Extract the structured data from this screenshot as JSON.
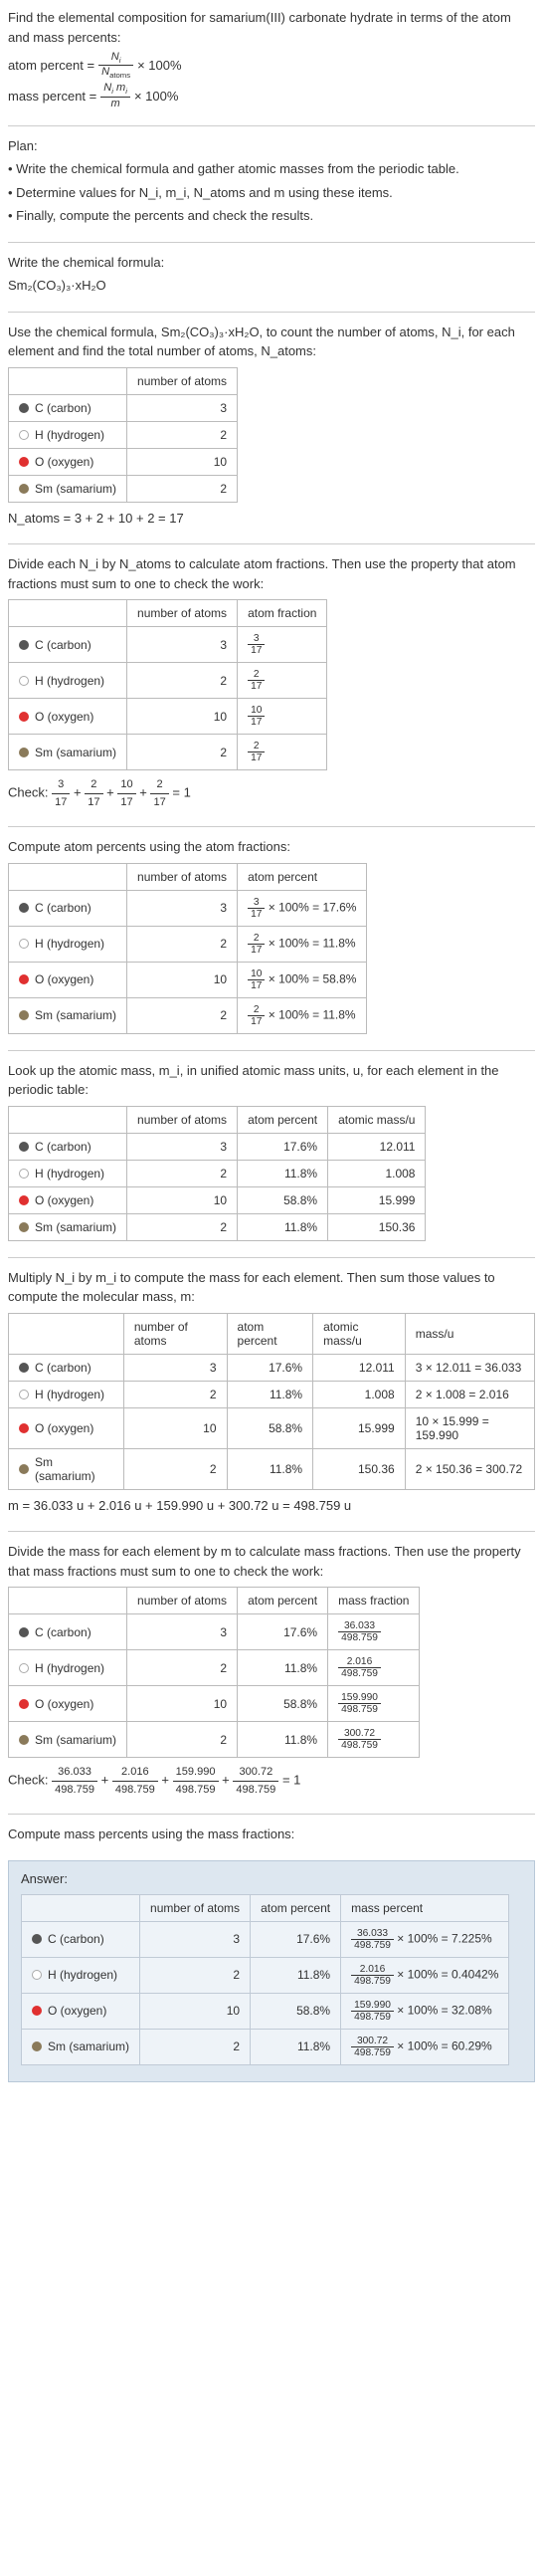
{
  "intro": {
    "line1": "Find the elemental composition for samarium(III) carbonate hydrate in terms of the atom and mass percents:",
    "atom_pct_label": "atom percent =",
    "atom_pct_rhs": "× 100%",
    "atom_pct_num": "N_i",
    "atom_pct_den": "N_atoms",
    "mass_pct_label": "mass percent =",
    "mass_pct_rhs": "× 100%",
    "mass_pct_num": "N_i m_i",
    "mass_pct_den": "m"
  },
  "plan": {
    "heading": "Plan:",
    "b1": "• Write the chemical formula and gather atomic masses from the periodic table.",
    "b2": "• Determine values for N_i, m_i, N_atoms and m using these items.",
    "b3": "• Finally, compute the percents and check the results."
  },
  "write_formula": {
    "heading": "Write the chemical formula:",
    "formula": "Sm₂(CO₃)₃·xH₂O"
  },
  "count_atoms": {
    "text": "Use the chemical formula, Sm₂(CO₃)₃·xH₂O, to count the number of atoms, N_i, for each element and find the total number of atoms, N_atoms:",
    "col_num": "number of atoms",
    "rows": [
      {
        "el": "C (carbon)",
        "n": "3"
      },
      {
        "el": "H (hydrogen)",
        "n": "2"
      },
      {
        "el": "O (oxygen)",
        "n": "10"
      },
      {
        "el": "Sm (samarium)",
        "n": "2"
      }
    ],
    "total": "N_atoms = 3 + 2 + 10 + 2 = 17"
  },
  "atom_fractions": {
    "text": "Divide each N_i by N_atoms to calculate atom fractions. Then use the property that atom fractions must sum to one to check the work:",
    "col_num": "number of atoms",
    "col_frac": "atom fraction",
    "rows": [
      {
        "el": "C (carbon)",
        "n": "3",
        "fnum": "3",
        "fden": "17"
      },
      {
        "el": "H (hydrogen)",
        "n": "2",
        "fnum": "2",
        "fden": "17"
      },
      {
        "el": "O (oxygen)",
        "n": "10",
        "fnum": "10",
        "fden": "17"
      },
      {
        "el": "Sm (samarium)",
        "n": "2",
        "fnum": "2",
        "fden": "17"
      }
    ],
    "check_label": "Check:",
    "check_expr": "3/17 + 2/17 + 10/17 + 2/17 = 1"
  },
  "atom_percents": {
    "text": "Compute atom percents using the atom fractions:",
    "col_num": "number of atoms",
    "col_pct": "atom percent",
    "rows": [
      {
        "el": "C (carbon)",
        "n": "3",
        "fnum": "3",
        "fden": "17",
        "pct": "17.6%"
      },
      {
        "el": "H (hydrogen)",
        "n": "2",
        "fnum": "2",
        "fden": "17",
        "pct": "11.8%"
      },
      {
        "el": "O (oxygen)",
        "n": "10",
        "fnum": "10",
        "fden": "17",
        "pct": "58.8%"
      },
      {
        "el": "Sm (samarium)",
        "n": "2",
        "fnum": "2",
        "fden": "17",
        "pct": "11.8%"
      }
    ]
  },
  "atomic_mass": {
    "text": "Look up the atomic mass, m_i, in unified atomic mass units, u, for each element in the periodic table:",
    "col_num": "number of atoms",
    "col_pct": "atom percent",
    "col_mass": "atomic mass/u",
    "rows": [
      {
        "el": "C (carbon)",
        "n": "3",
        "pct": "17.6%",
        "m": "12.011"
      },
      {
        "el": "H (hydrogen)",
        "n": "2",
        "pct": "11.8%",
        "m": "1.008"
      },
      {
        "el": "O (oxygen)",
        "n": "10",
        "pct": "58.8%",
        "m": "15.999"
      },
      {
        "el": "Sm (samarium)",
        "n": "2",
        "pct": "11.8%",
        "m": "150.36"
      }
    ]
  },
  "mass_each": {
    "text": "Multiply N_i by m_i to compute the mass for each element. Then sum those values to compute the molecular mass, m:",
    "col_num": "number of atoms",
    "col_pct": "atom percent",
    "col_mass": "atomic mass/u",
    "col_massu": "mass/u",
    "rows": [
      {
        "el": "C (carbon)",
        "n": "3",
        "pct": "17.6%",
        "m": "12.011",
        "calc": "3 × 12.011 = 36.033"
      },
      {
        "el": "H (hydrogen)",
        "n": "2",
        "pct": "11.8%",
        "m": "1.008",
        "calc": "2 × 1.008 = 2.016"
      },
      {
        "el": "O (oxygen)",
        "n": "10",
        "pct": "58.8%",
        "m": "15.999",
        "calc": "10 × 15.999 = 159.990"
      },
      {
        "el": "Sm (samarium)",
        "n": "2",
        "pct": "11.8%",
        "m": "150.36",
        "calc": "2 × 150.36 = 300.72"
      }
    ],
    "total": "m = 36.033 u + 2.016 u + 159.990 u + 300.72 u = 498.759 u"
  },
  "mass_fractions": {
    "text": "Divide the mass for each element by m to calculate mass fractions. Then use the property that mass fractions must sum to one to check the work:",
    "col_num": "number of atoms",
    "col_pct": "atom percent",
    "col_mf": "mass fraction",
    "rows": [
      {
        "el": "C (carbon)",
        "n": "3",
        "pct": "17.6%",
        "fnum": "36.033",
        "fden": "498.759"
      },
      {
        "el": "H (hydrogen)",
        "n": "2",
        "pct": "11.8%",
        "fnum": "2.016",
        "fden": "498.759"
      },
      {
        "el": "O (oxygen)",
        "n": "10",
        "pct": "58.8%",
        "fnum": "159.990",
        "fden": "498.759"
      },
      {
        "el": "Sm (samarium)",
        "n": "2",
        "pct": "11.8%",
        "fnum": "300.72",
        "fden": "498.759"
      }
    ],
    "check_label": "Check:",
    "check_parts": [
      {
        "num": "36.033",
        "den": "498.759"
      },
      {
        "num": "2.016",
        "den": "498.759"
      },
      {
        "num": "159.990",
        "den": "498.759"
      },
      {
        "num": "300.72",
        "den": "498.759"
      }
    ],
    "check_eq": "= 1"
  },
  "mass_percents": {
    "text": "Compute mass percents using the mass fractions:"
  },
  "answer": {
    "label": "Answer:",
    "col_num": "number of atoms",
    "col_pct": "atom percent",
    "col_mpct": "mass percent",
    "rows": [
      {
        "el": "C (carbon)",
        "n": "3",
        "pct": "17.6%",
        "fnum": "36.033",
        "fden": "498.759",
        "res": "100% = 7.225%"
      },
      {
        "el": "H (hydrogen)",
        "n": "2",
        "pct": "11.8%",
        "fnum": "2.016",
        "fden": "498.759",
        "res": "100% = 0.4042%"
      },
      {
        "el": "O (oxygen)",
        "n": "10",
        "pct": "58.8%",
        "fnum": "159.990",
        "fden": "498.759",
        "res": "100% = 32.08%"
      },
      {
        "el": "Sm (samarium)",
        "n": "2",
        "pct": "11.8%",
        "fnum": "300.72",
        "fden": "498.759",
        "res": "100% = 60.29%"
      }
    ]
  },
  "labels": {
    "c": "C (carbon)",
    "h": "H (hydrogen)",
    "o": "O (oxygen)",
    "sm": "Sm (samarium)",
    "times100": "× 100% =",
    "plus": " + "
  },
  "chart_data": {
    "type": "table",
    "title": "Elemental composition of Sm2(CO3)3·xH2O",
    "elements": [
      "C",
      "H",
      "O",
      "Sm"
    ],
    "number_of_atoms": [
      3,
      2,
      10,
      2
    ],
    "N_atoms_total": 17,
    "atom_fraction_num": [
      3,
      2,
      10,
      2
    ],
    "atom_fraction_den": 17,
    "atom_percent": [
      17.6,
      11.8,
      58.8,
      11.8
    ],
    "atomic_mass_u": [
      12.011,
      1.008,
      15.999,
      150.36
    ],
    "mass_u": [
      36.033,
      2.016,
      159.99,
      300.72
    ],
    "m_total_u": 498.759,
    "mass_fraction_num": [
      36.033,
      2.016,
      159.99,
      300.72
    ],
    "mass_fraction_den": 498.759,
    "mass_percent": [
      7.225,
      0.4042,
      32.08,
      60.29
    ]
  }
}
